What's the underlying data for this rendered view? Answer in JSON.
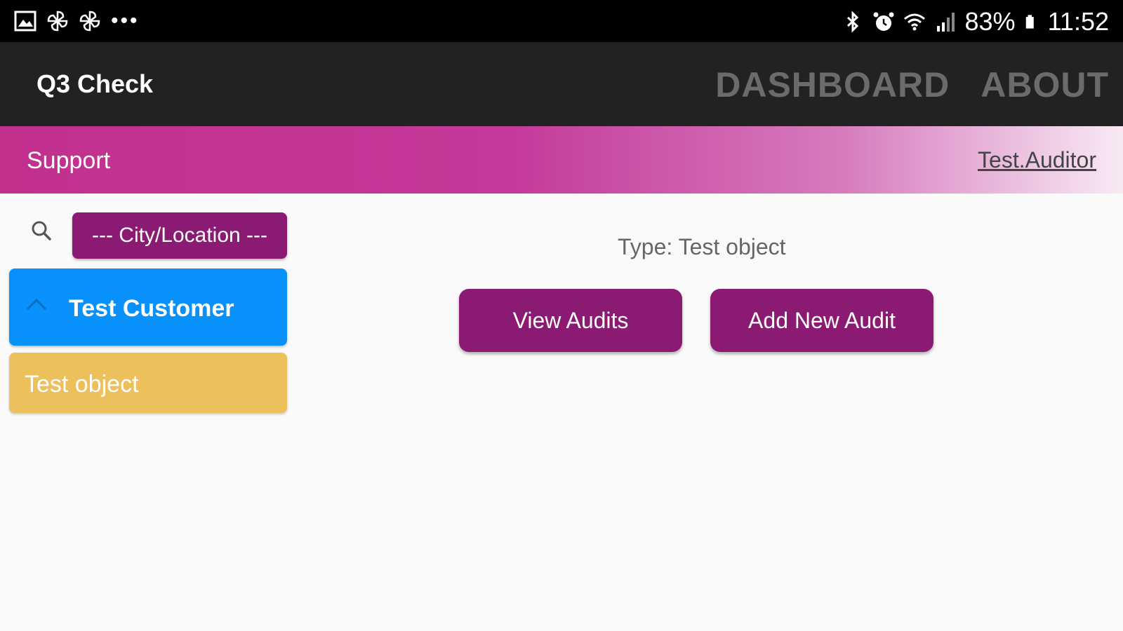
{
  "status_bar": {
    "left_icons": [
      "gallery-icon",
      "pinwheel-icon",
      "pinwheel-icon"
    ],
    "more": "•••",
    "battery": "83%",
    "time": "11:52"
  },
  "appbar": {
    "title": "Q3 Check",
    "nav": [
      "DASHBOARD",
      "ABOUT"
    ]
  },
  "subbar": {
    "title": "Support",
    "user": "Test.Auditor"
  },
  "sidebar": {
    "location_select": "--- City/Location ---",
    "customer": "Test Customer",
    "object": "Test object"
  },
  "main": {
    "type_line": "Type: Test object",
    "view_audits": "View Audits",
    "add_audit": "Add New Audit"
  },
  "colors": {
    "brand": "#8b1a73",
    "customer_blue": "#0891fa",
    "object_yellow": "#ecc05a",
    "gradient_start": "#c2308e"
  }
}
